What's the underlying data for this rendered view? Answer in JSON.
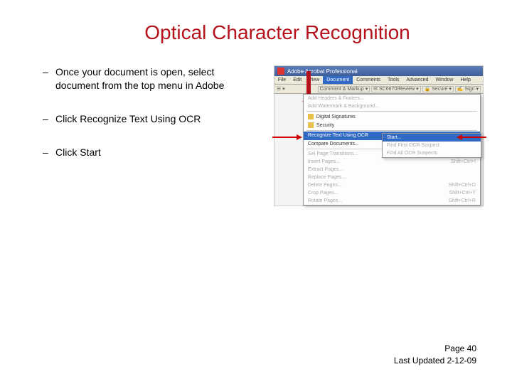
{
  "title": "Optical Character Recognition",
  "bullets": [
    "Once your document is open, select document from the top menu in Adobe",
    "Click Recognize Text Using OCR",
    "Click Start"
  ],
  "app": {
    "window_title": "Adobe Acrobat Professional",
    "menubar": {
      "items": [
        "File",
        "Edit",
        "View",
        "Document",
        "Comments",
        "Tools",
        "Advanced",
        "Window",
        "Help"
      ],
      "selected_index": 3
    },
    "toolbar_left": "☰ ▾",
    "toolbar_right": {
      "comment_markup": "Comment & Markup ▾",
      "send": "✉ SC6670/Review ▾",
      "secure": "🔒 Secure ▾",
      "sign": "✍ Sign ▾"
    },
    "dropdown": {
      "header_footer": "Add Headers & Footers...",
      "watermark": "Add Watermark & Background...",
      "digital_signatures": "Digital Signatures",
      "security": "Security",
      "recognize": "Recognize Text Using OCR",
      "compare": "Compare Documents...",
      "set_page": "Set Page Transitions...",
      "insert": "Insert Pages...",
      "extract": "Extract Pages...",
      "replace": "Replace Pages...",
      "delete": "Delete Pages...",
      "crop": "Crop Pages...",
      "rotate": "Rotate Pages...",
      "shortcuts": {
        "insert": "Shift+Ctrl+I",
        "delete": "Shift+Ctrl+D",
        "crop": "Shift+Ctrl+T",
        "rotate": "Shift+Ctrl+R"
      }
    },
    "submenu": {
      "start": "Start...",
      "find_first": "Find First OCR Suspect",
      "find_all": "Find All OCR Suspects"
    }
  },
  "footer": {
    "page": "Page 40",
    "updated": "Last Updated 2-12-09"
  }
}
